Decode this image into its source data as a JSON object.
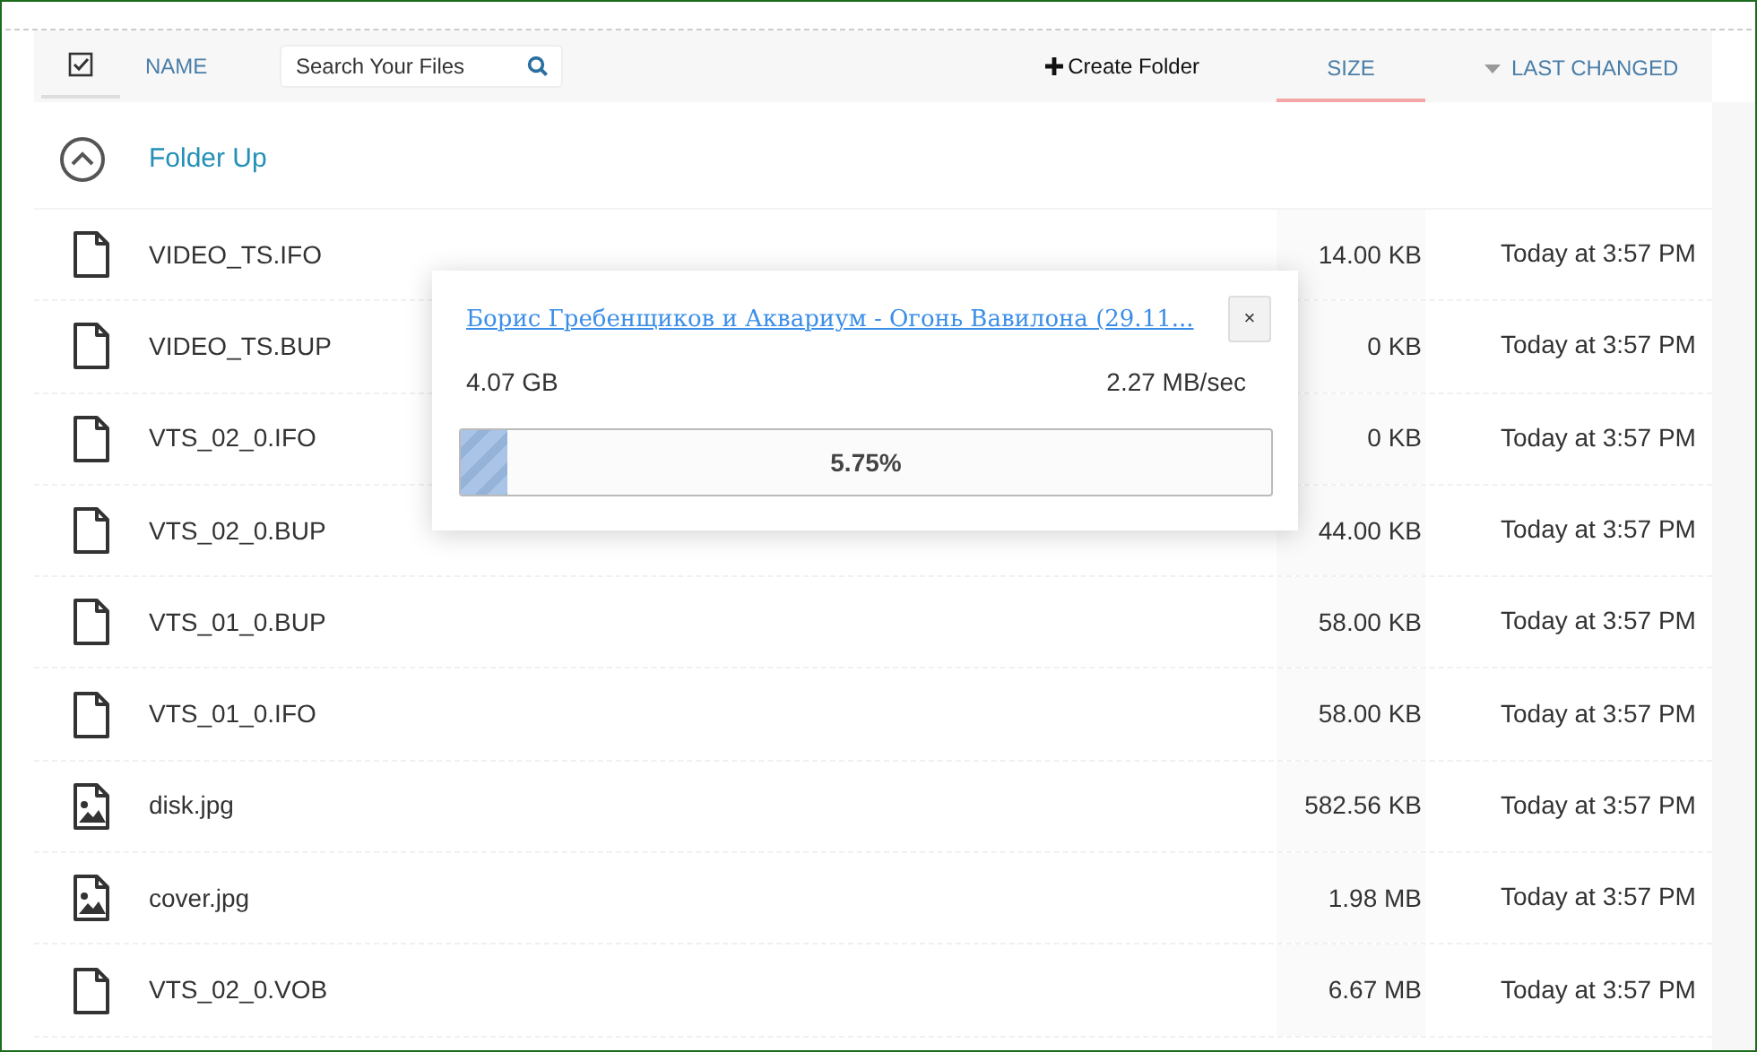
{
  "header": {
    "select_all": {
      "checked": true
    },
    "name_column": "NAME",
    "search": {
      "placeholder": "Search Your Files"
    },
    "create_folder": "Create Folder",
    "size_column": {
      "label": "SIZE",
      "selected": true
    },
    "last_changed_column": {
      "label": "LAST CHANGED",
      "selected": false
    }
  },
  "folder_up": "Folder Up",
  "files": [
    {
      "kind": "file",
      "name": "VIDEO_TS.IFO",
      "size": "14.00 KB",
      "changed": "Today at 3:57 PM"
    },
    {
      "kind": "file",
      "name": "VIDEO_TS.BUP",
      "size": "0 KB",
      "changed": "Today at 3:57 PM"
    },
    {
      "kind": "file",
      "name": "VTS_02_0.IFO",
      "size": "0 KB",
      "changed": "Today at 3:57 PM"
    },
    {
      "kind": "file",
      "name": "VTS_02_0.BUP",
      "size": "44.00 KB",
      "changed": "Today at 3:57 PM"
    },
    {
      "kind": "file",
      "name": "VTS_01_0.BUP",
      "size": "58.00 KB",
      "changed": "Today at 3:57 PM"
    },
    {
      "kind": "file",
      "name": "VTS_01_0.IFO",
      "size": "58.00 KB",
      "changed": "Today at 3:57 PM"
    },
    {
      "kind": "image",
      "name": "disk.jpg",
      "size": "582.56 KB",
      "changed": "Today at 3:57 PM"
    },
    {
      "kind": "image",
      "name": "cover.jpg",
      "size": "1.98 MB",
      "changed": "Today at 3:57 PM"
    },
    {
      "kind": "file",
      "name": "VTS_02_0.VOB",
      "size": "6.67 MB",
      "changed": "Today at 3:57 PM"
    }
  ],
  "upload_dialog": {
    "title": "Борис Гребенщиков и Аквариум - Огонь Вавилона (29.11...",
    "close": "×",
    "total": "4.07 GB",
    "speed": "2.27 MB/sec",
    "level": 0.0575,
    "percent": "5.75%"
  }
}
